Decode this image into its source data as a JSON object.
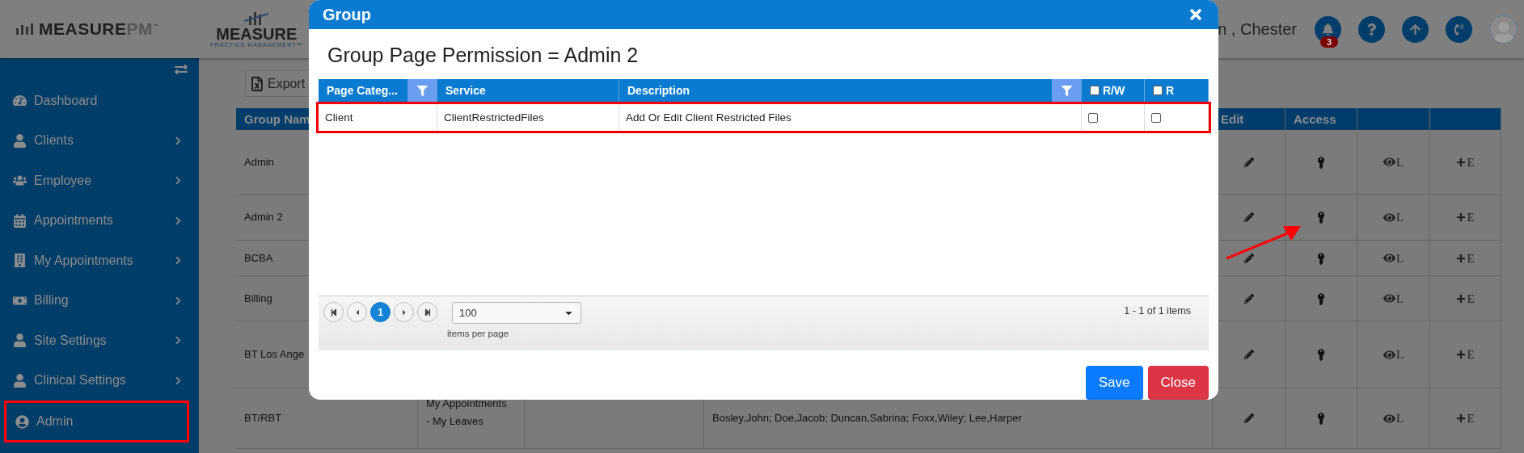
{
  "header": {
    "logo": {
      "text": "MEASURE",
      "accent": "PM",
      "mark": "™"
    },
    "brand": {
      "text": "MEASURE",
      "tagline": "PRACTICE MANAGEMENT™"
    },
    "user": "n , Chester",
    "notifications": "3"
  },
  "sidebar": {
    "items": [
      {
        "label": "Dashboard",
        "has_submenu": false,
        "highlighted": false
      },
      {
        "label": "Clients",
        "has_submenu": true,
        "highlighted": false
      },
      {
        "label": "Employee",
        "has_submenu": true,
        "highlighted": false
      },
      {
        "label": "Appointments",
        "has_submenu": true,
        "highlighted": false
      },
      {
        "label": "My Appointments",
        "has_submenu": true,
        "highlighted": false
      },
      {
        "label": "Billing",
        "has_submenu": true,
        "highlighted": false
      },
      {
        "label": "Site Settings",
        "has_submenu": true,
        "highlighted": false
      },
      {
        "label": "Clinical Settings",
        "has_submenu": true,
        "highlighted": false
      },
      {
        "label": "Admin",
        "has_submenu": false,
        "highlighted": true
      }
    ]
  },
  "toolbar": {
    "export": "Export"
  },
  "table": {
    "columns": [
      {
        "label": "Group Nam"
      },
      {},
      {},
      {},
      {
        "label": "Edit"
      },
      {
        "label": "Access"
      },
      {},
      {}
    ],
    "rows": [
      {
        "name": "Admin",
        "view": "L",
        "add": "E"
      },
      {
        "name": "Admin 2",
        "view": "L",
        "add": "E"
      },
      {
        "name": "BCBA",
        "view": "L",
        "add": "E"
      },
      {
        "name": "Billing",
        "view": "L",
        "add": "E"
      },
      {
        "name": "BT Los Ange",
        "view": "L",
        "add": "E"
      },
      {
        "name": "BT/RBT",
        "services": "My Appointments - My Leaves",
        "members": "Bosley,John; Doe,Jacob; Duncan,Sabrina; Foxx,Wiley; Lee,Harper",
        "view": "L",
        "add": "E"
      }
    ]
  },
  "annotation": {
    "kind": "arrow"
  },
  "dialog": {
    "title": "Group",
    "heading": "Group Page Permission = Admin 2",
    "grid": {
      "columns": [
        {
          "label": "Page Categ...",
          "kind": "filter"
        },
        {
          "label": "Service",
          "kind": "text"
        },
        {
          "label": "Description",
          "kind": "filter"
        },
        {
          "label": "R/W",
          "kind": "checkbox",
          "checked": false
        },
        {
          "label": "R",
          "kind": "checkbox",
          "checked": false
        }
      ],
      "rows": [
        {
          "category": "Client",
          "service": "ClientRestrictedFiles",
          "description": "Add Or Edit Client Restricted Files",
          "rw": false,
          "r": false,
          "highlighted": true
        }
      ]
    },
    "pager": {
      "pages": [
        {
          "label": "1",
          "selected": true
        }
      ],
      "page_size": "100",
      "page_size_label": "items per page",
      "summary": "1 - 1 of 1 items"
    },
    "buttons": [
      {
        "label": "Save",
        "kind": "primary"
      },
      {
        "label": "Close",
        "kind": "danger"
      }
    ]
  }
}
